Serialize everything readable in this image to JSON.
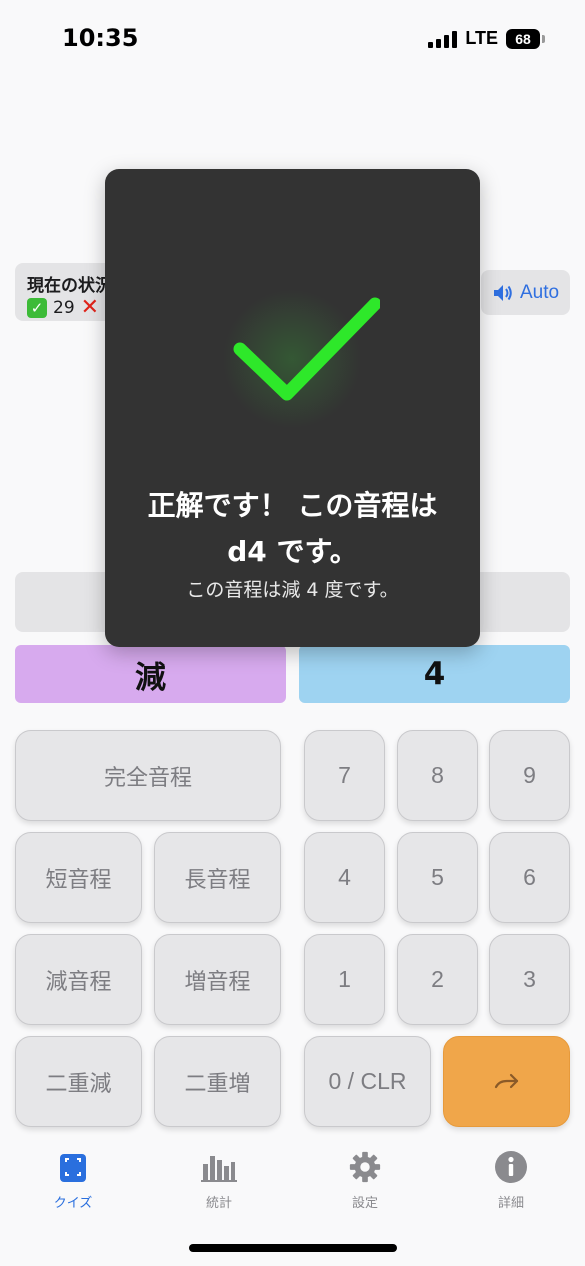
{
  "status_bar": {
    "time": "10:35",
    "network": "LTE",
    "battery": "68"
  },
  "score": {
    "title": "現在の状況",
    "correct_count": "29"
  },
  "audio": {
    "label": "Auto",
    "icon": "speaker-icon"
  },
  "selection": {
    "quality": "減",
    "number": "4"
  },
  "feedback": {
    "title": "正解です！ この音程は d4 です。",
    "subtitle": "この音程は減 4 度です。",
    "icon": "checkmark-icon",
    "check_color": "#2ee82a"
  },
  "keypad": {
    "quality_keys": [
      "完全音程",
      "短音程",
      "長音程",
      "減音程",
      "増音程",
      "二重減",
      "二重増"
    ],
    "number_keys": [
      "7",
      "8",
      "9",
      "4",
      "5",
      "6",
      "1",
      "2",
      "3"
    ],
    "clear": "0 / CLR",
    "enter_icon": "arrow-right-icon"
  },
  "tabs": [
    {
      "label": "クイズ",
      "icon": "quiz-icon"
    },
    {
      "label": "統計",
      "icon": "chart-icon"
    },
    {
      "label": "設定",
      "icon": "gear-icon"
    },
    {
      "label": "詳細",
      "icon": "info-icon"
    }
  ],
  "colors": {
    "accent": "#2a6fde",
    "quality_bg": "#d7aaee",
    "number_bg": "#9ed3f1",
    "enter_bg": "#f0a64a"
  }
}
